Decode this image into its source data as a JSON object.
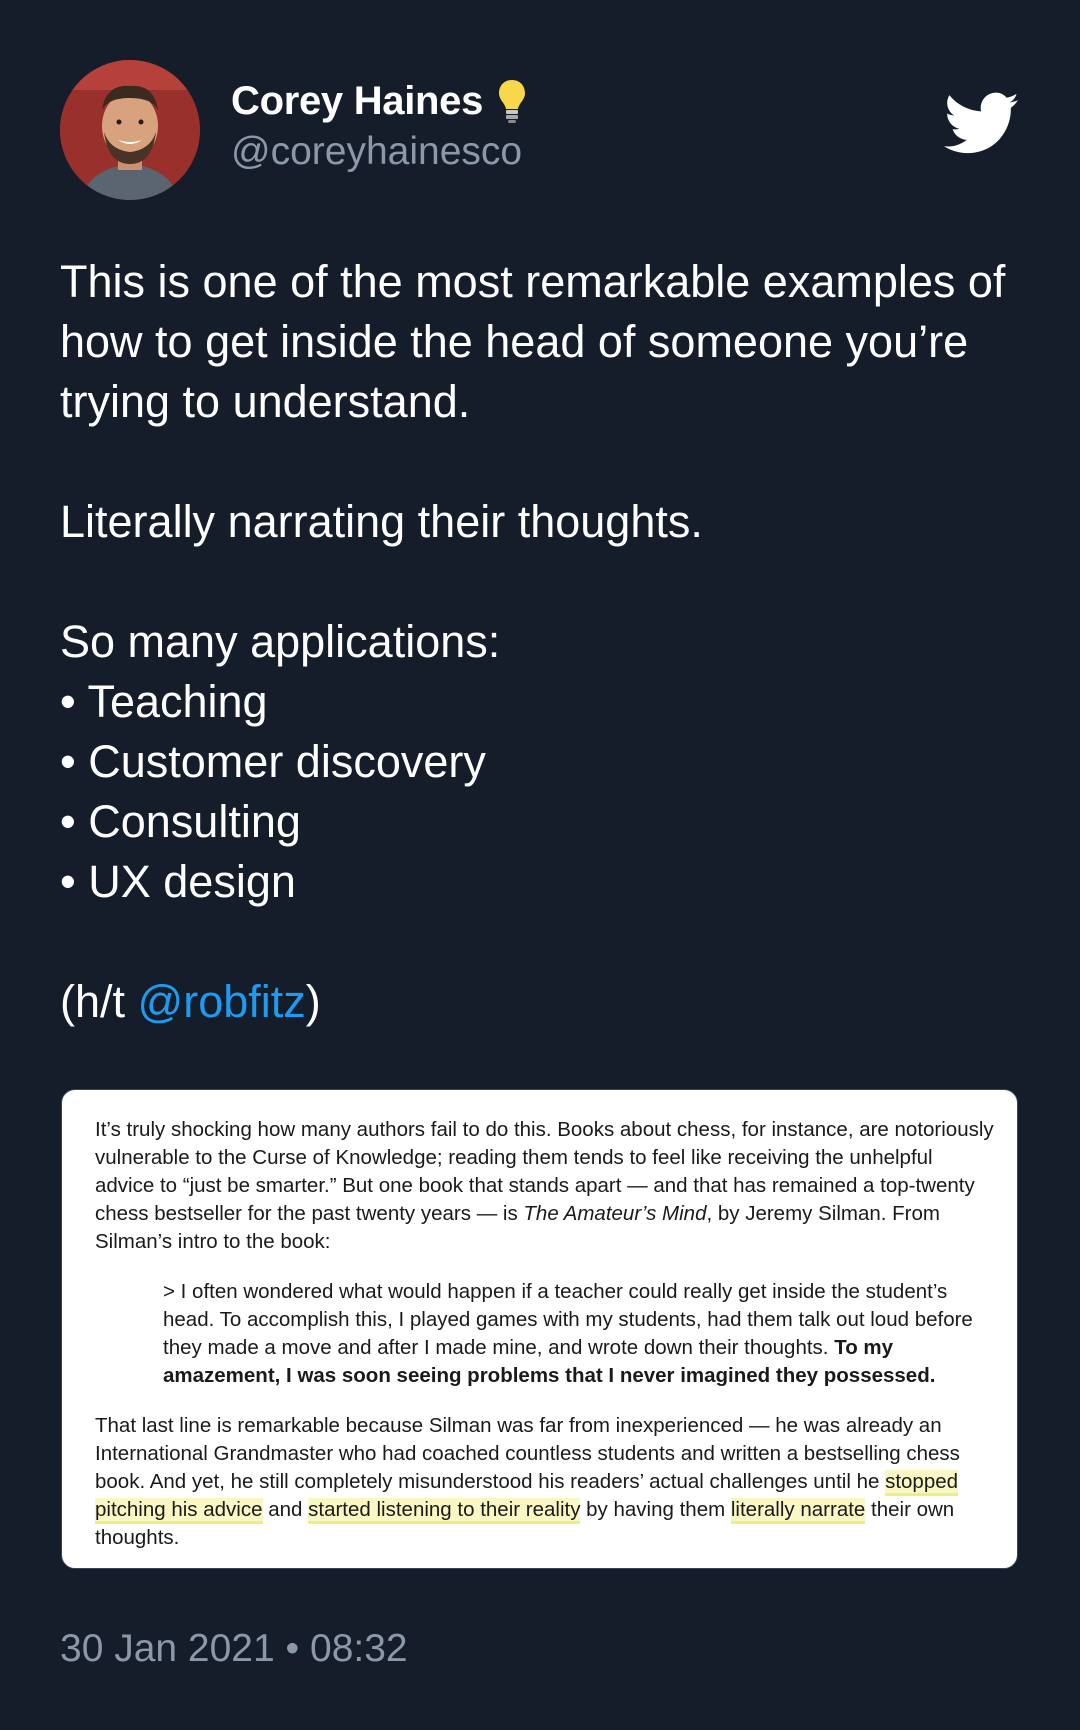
{
  "author": {
    "display_name": "Corey Haines",
    "handle": "@coreyhainesco",
    "avatar_icon": "avatar-photo",
    "badge_icon": "lightbulb-icon"
  },
  "brand": {
    "icon": "twitter-bird-icon",
    "color": "#ffffff"
  },
  "tweet": {
    "line1": "This is one of the most remarkable examples of how to get inside the head of someone you’re trying to understand.",
    "line2": "Literally narrating their thoughts.",
    "list_intro": "So many applications:",
    "list_items": [
      "• Teaching",
      "• Customer discovery",
      "• Consulting",
      "• UX design"
    ],
    "hat_tip_prefix": "(h/t ",
    "hat_tip_mention": "@robfitz",
    "hat_tip_suffix": ")"
  },
  "attachment": {
    "para1_a": "It’s truly shocking how many authors fail to do this. Books about chess, for instance, are notoriously vulnerable to the Curse of Knowledge; reading them tends to feel like receiving the unhelpful advice to “just be smarter.” But one book that stands apart — and that has remained a top-twenty chess bestseller for the past twenty years — is ",
    "para1_title": "The Amateur’s Mind",
    "para1_b": ", by Jeremy Silman. From Silman’s intro to the book:",
    "quote_a": "> I often wondered what would happen if a teacher could really get inside the student’s head. To accomplish this, I played games with my students, had them talk out loud before they made a move and after I made mine, and wrote down their thoughts. ",
    "quote_bold": "To my amazement, I was soon seeing problems that I never imagined they possessed.",
    "para2_a": "That last line is remarkable because Silman was far from inexperienced — he was already an International Grandmaster who had coached countless students and written a bestselling chess book. And yet, he still completely misunderstood his readers’ actual challenges until he ",
    "para2_hl1": "stopped pitching his advice",
    "para2_b": " and ",
    "para2_hl2": "started listening to their reality",
    "para2_c": " by having them ",
    "para2_hl3": "literally narrate",
    "para2_d": " their own thoughts."
  },
  "timestamp": "30 Jan 2021 • 08:32",
  "colors": {
    "background": "#151d2a",
    "secondary_text": "#8b98a5",
    "link": "#1d9bf0",
    "highlight": "#eeec5a"
  }
}
